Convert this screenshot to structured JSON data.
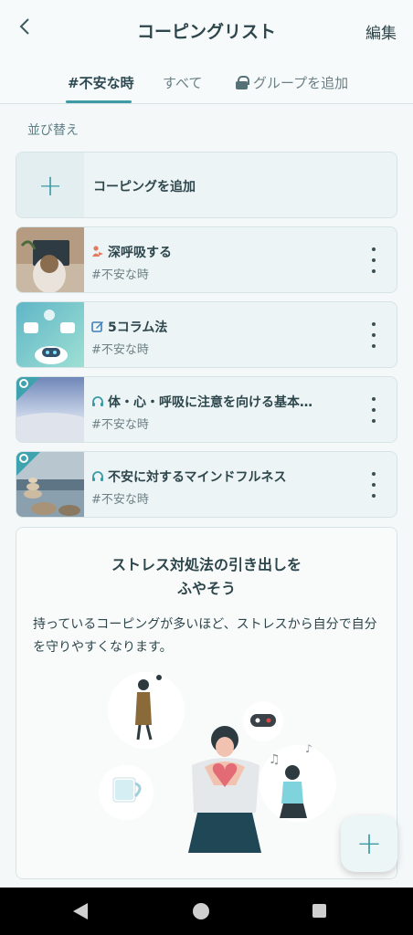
{
  "header": {
    "back_icon": "chevron-left-icon",
    "title": "コーピングリスト",
    "edit_label": "編集"
  },
  "tabs": [
    {
      "label": "#不安な時",
      "active": true
    },
    {
      "label": "すべて",
      "active": false
    },
    {
      "label": "グループを追加",
      "icon": "lock-icon",
      "active": false
    }
  ],
  "sort_label": "並び替え",
  "add_coping_label": "コーピングを追加",
  "items": [
    {
      "title": "深呼吸する",
      "tag": "#不安な時",
      "type_icon": "person-heart-icon",
      "badge": false
    },
    {
      "title": "5コラム法",
      "tag": "#不安な時",
      "type_icon": "edit-icon",
      "badge": false
    },
    {
      "title": "体・心・呼吸に注意を向ける基本…",
      "tag": "#不安な時",
      "type_icon": "headphones-icon",
      "badge": true
    },
    {
      "title": "不安に対するマインドフルネス",
      "tag": "#不安な時",
      "type_icon": "headphones-icon",
      "badge": true
    }
  ],
  "promo": {
    "title_line1": "ストレス対処法の引き出しを",
    "title_line2": "ふやそう",
    "text": "持っているコーピングが多いほど、ストレスから自分で自分を守りやすくなります。"
  },
  "colors": {
    "accent": "#3b9aa5",
    "card_bg": "#edf4f5",
    "text": "#2d464c"
  }
}
